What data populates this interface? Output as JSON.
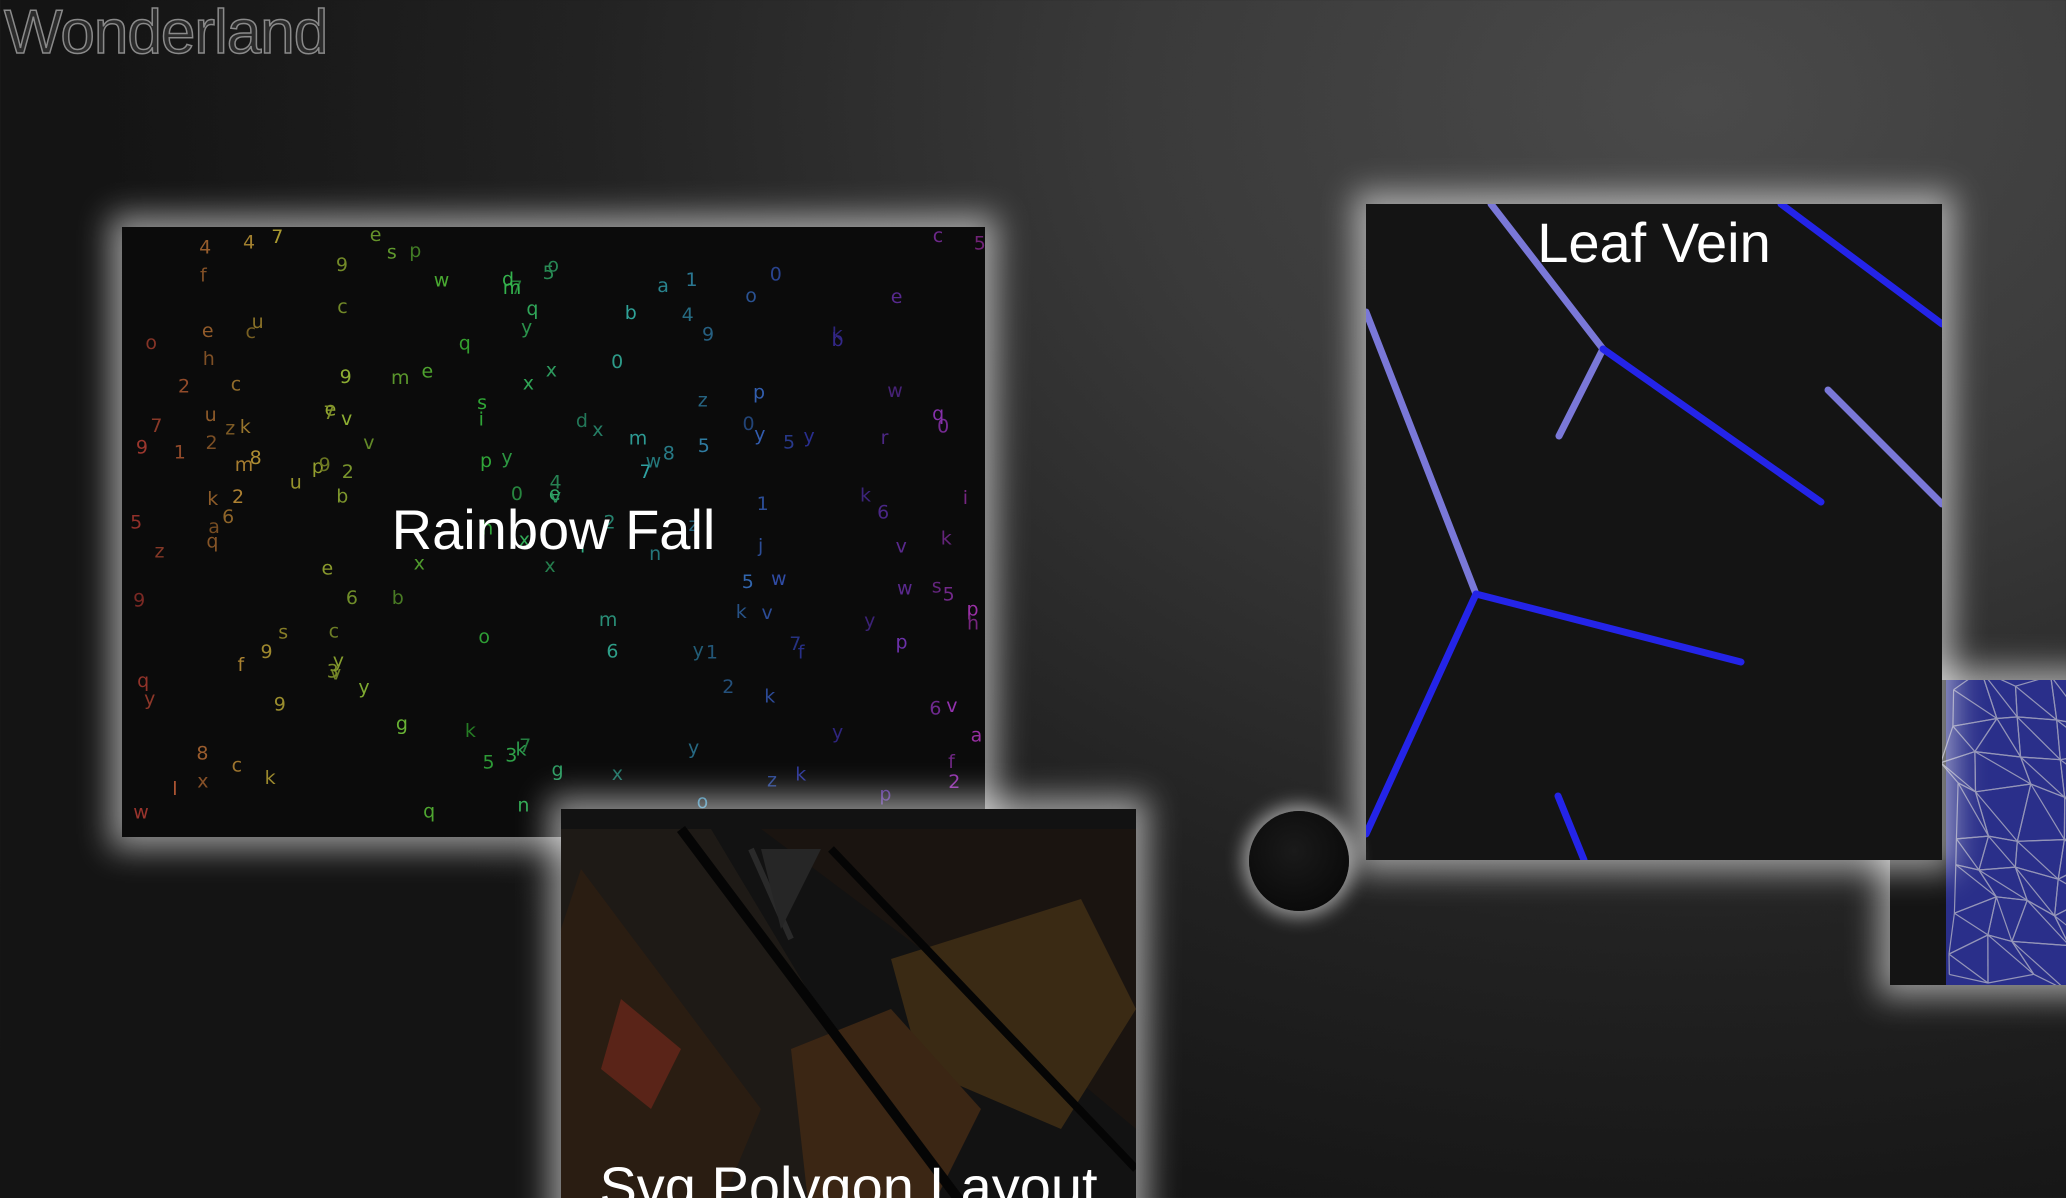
{
  "site": {
    "title": "Wonderland"
  },
  "cards": {
    "rainbow_fall": {
      "title": "Rainbow Fall"
    },
    "leaf_vein": {
      "title": "Leaf Vein"
    },
    "svg_polygon_layout": {
      "title": "Svg Polygon Layout"
    },
    "partial_mesh": {
      "title": ""
    }
  },
  "colors": {
    "leaf_vein_bright": "#2424e8",
    "leaf_vein_pale": "#7a78d8",
    "card_glow": "#ffffff",
    "mesh_blue": "#2a2f8a",
    "mesh_lines": "#b8b8c8"
  },
  "rainbow_glyphs": "xb8s1c2l2uzix5x6747o0e0vy2v7pp9mkqw9yk4yo5eca6qykwfsyvcgnhkpdmk31h9dkq3wb5e2p1e9fzexp6h5vkfb5xmjw8zkr9qnym0z59uo7a"
}
